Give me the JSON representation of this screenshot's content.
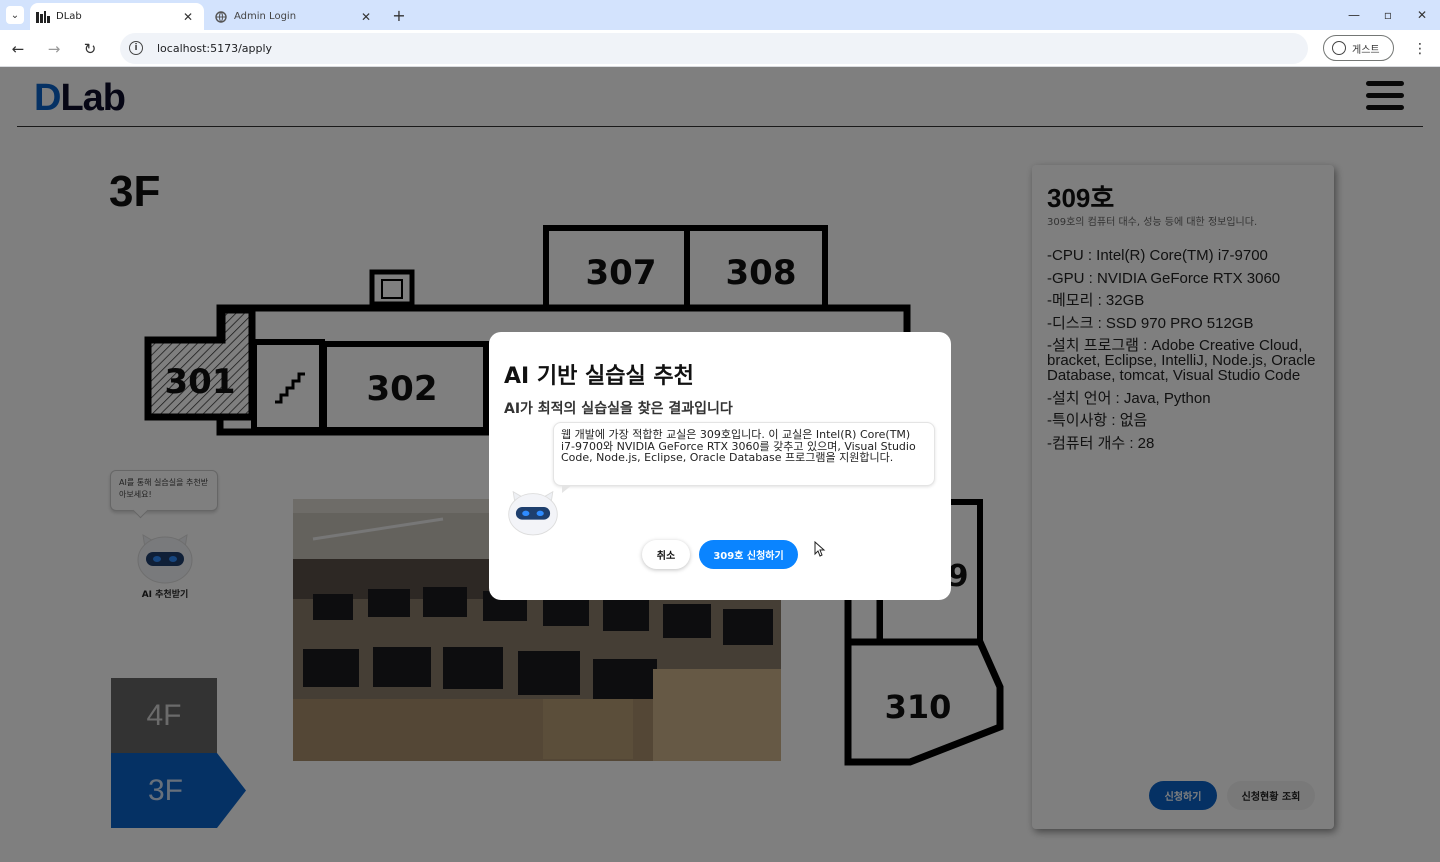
{
  "browser": {
    "tabs": [
      {
        "title": "DLab",
        "active": true
      },
      {
        "title": "Admin Login",
        "active": false
      }
    ],
    "url": "localhost:5173/apply",
    "profile_label": "게스트"
  },
  "header": {
    "logo_d": "D",
    "logo_rest": "Lab"
  },
  "floor": {
    "title": "3F",
    "rooms": [
      "301",
      "302",
      "307",
      "308",
      "310"
    ],
    "partial_rooms": [
      "9"
    ],
    "buttons": [
      {
        "label": "4F",
        "selected": false
      },
      {
        "label": "3F",
        "selected": true
      }
    ]
  },
  "ai_widget": {
    "bubble_text": "AI를 통해 실습실을 추천받아보세요!",
    "label": "AI 추천받기"
  },
  "room_info": {
    "title": "309호",
    "subtitle": "309호의 컴퓨터 대수, 성능 등에 대한 정보입니다.",
    "specs": [
      "-CPU : Intel(R) Core(TM) i7-9700",
      "-GPU : NVIDIA GeForce RTX 3060",
      "-메모리 : 32GB",
      "-디스크 : SSD 970 PRO 512GB",
      "-설치 프로그램 : Adobe Creative Cloud, bracket, Eclipse, IntelliJ, Node.js, Oracle Database, tomcat, Visual Studio Code",
      "-설치 언어 : Java, Python",
      "-특이사항 : 없음",
      "-컴퓨터 개수 : 28"
    ],
    "apply_label": "신청하기",
    "status_label": "신청현황 조회"
  },
  "modal": {
    "title": "AI 기반 실습실 추천",
    "subtitle": "AI가 최적의 실습실을 찾은 결과입니다",
    "message": "웹 개발에 가장 적합한 교실은 309호입니다. 이 교실은 Intel(R) Core(TM) i7-9700와 NVIDIA GeForce RTX 3060를 갖추고 있으며, Visual Studio Code, Node.js, Eclipse, Oracle Database 프로그램을 지원합니다.",
    "cancel_label": "취소",
    "confirm_label": "309호 신청하기"
  },
  "colors": {
    "brand_blue": "#0b63c9",
    "confirm_blue": "#0a84ff",
    "overlay": "rgba(0,0,0,0.5)"
  }
}
